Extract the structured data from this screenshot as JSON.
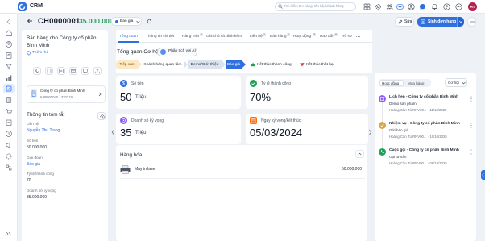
{
  "app": {
    "name": "CRM",
    "user_initials": "HT"
  },
  "search": {
    "placeholder": "Tìm kiếm tên hàng, tên hộ, khách hàng"
  },
  "header": {
    "deal_code": "CH0000001",
    "separator": "-",
    "amount": "35.000.000",
    "stage": "Báo giá",
    "edit_label": "Sửa",
    "create_order_label": "Sinh đơn hàng"
  },
  "left": {
    "company": "Bán hàng cho Công ty cổ phần Bình Minh",
    "add_tag": "Thêm thẻ",
    "company_card": {
      "name": "Công ty cổ phần Bình Minh",
      "meta": "KH0000040 · 370319..."
    },
    "summary_title": "Thông tin tóm tắt",
    "fields": [
      {
        "label": "Liên hệ",
        "value": "Nguyễn Thu Trang",
        "link": true
      },
      {
        "label": "Số tiền",
        "value": "50.000.000",
        "link": false
      },
      {
        "label": "Giai đoạn",
        "value": "Báo giá",
        "link": true
      },
      {
        "label": "Tỷ lệ thành công",
        "value": "70",
        "link": false
      },
      {
        "label": "Doanh số kỳ vọng",
        "value": "35.000.000",
        "link": false
      }
    ]
  },
  "tabs": [
    {
      "label": "Tổng quan",
      "badge": ""
    },
    {
      "label": "Thông tin chi tiết",
      "badge": ""
    },
    {
      "label": "Hàng hóa",
      "badge": "1"
    },
    {
      "label": "Ghi chú và đính kèm",
      "badge": ""
    },
    {
      "label": "Liên hệ",
      "badge": "1"
    },
    {
      "label": "Bán hàng",
      "badge": "1"
    },
    {
      "label": "Hoạt động",
      "badge": "3"
    },
    {
      "label": "Trao đổi",
      "badge": "0"
    },
    {
      "label": "Hồ sơ",
      "badge": ""
    }
  ],
  "overview": {
    "title": "Tổng quan Cơ hội",
    "ai_button": "Phân tích với AI",
    "stages": [
      "Tiếp cận",
      "Khách hàng quan tâm",
      "Demo/Giới thiệu",
      "Báo giá"
    ],
    "won_label": "Kết thúc thành công",
    "lost_label": "Kết thúc thất bại"
  },
  "kpis": [
    {
      "label": "Số tiền",
      "value": "50",
      "unit": "Triệu",
      "color": "#2f6fde"
    },
    {
      "label": "Tỷ lệ thành công",
      "value": "70%",
      "unit": "",
      "color": "#22a05a"
    },
    {
      "label": "Doanh số kỳ vọng",
      "value": "35",
      "unit": "Triệu",
      "color": "#8b5cf6"
    },
    {
      "label": "Ngày ký vọng/kết thúc",
      "value": "05/03/2024",
      "unit": "",
      "color": "#f97316"
    }
  ],
  "products": {
    "title": "Hàng hóa",
    "items": [
      {
        "name": "Máy in laser",
        "price": "50.000.000"
      }
    ]
  },
  "activity": {
    "tab_active": "Hoạt động",
    "tab_other": "Mua hàng",
    "filter": "Cơ hội",
    "items": [
      {
        "title": "Lịch hẹn - Công ty cổ phần Bình Minh",
        "desc": "Demo sản phẩm",
        "meta": "Hoàng Cần Tú RNV00... · 11/10/2025",
        "color": "#8b5cf6"
      },
      {
        "title": "Nhiệm vụ - Công ty cổ phần Bình Minh",
        "desc": "Gửi báo giá",
        "meta": "Hoàng Cần Tú RNV00... · 10/10/2025",
        "color": "#d9a441"
      },
      {
        "title": "Cuộc gọi - Công ty cổ phần Bình Minh",
        "desc": "Gọi tư vấn",
        "meta": "Hoàng Cần Tú RNV00... · 09/10/2025",
        "color": "#22a05a"
      }
    ]
  }
}
